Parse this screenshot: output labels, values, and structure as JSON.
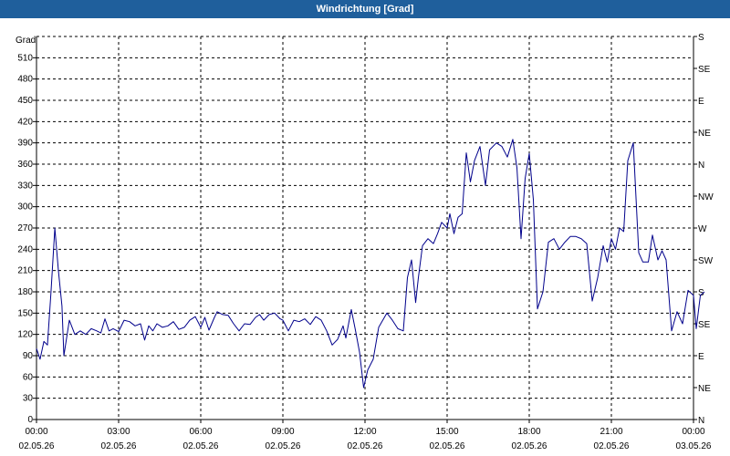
{
  "window": {
    "title": "Windrichtung [Grad]"
  },
  "chart_data": {
    "type": "line",
    "ylabel": "Grad",
    "ylim": [
      0,
      540
    ],
    "y_ticks": [
      0,
      30,
      60,
      90,
      120,
      150,
      180,
      210,
      240,
      270,
      300,
      330,
      360,
      390,
      420,
      450,
      480,
      510
    ],
    "right_axis_labels": [
      {
        "y": 0,
        "label": "N"
      },
      {
        "y": 45,
        "label": "NE"
      },
      {
        "y": 90,
        "label": "E"
      },
      {
        "y": 135,
        "label": "SE"
      },
      {
        "y": 180,
        "label": "S"
      },
      {
        "y": 225,
        "label": "SW"
      },
      {
        "y": 270,
        "label": "W"
      },
      {
        "y": 315,
        "label": "NW"
      },
      {
        "y": 360,
        "label": "N"
      },
      {
        "y": 405,
        "label": "NE"
      },
      {
        "y": 450,
        "label": "E"
      },
      {
        "y": 495,
        "label": "SE"
      },
      {
        "y": 540,
        "label": "S"
      }
    ],
    "x_ticks": [
      {
        "hour": 0,
        "time": "00:00",
        "date": "02.05.26"
      },
      {
        "hour": 3,
        "time": "03:00",
        "date": "02.05.26"
      },
      {
        "hour": 6,
        "time": "06:00",
        "date": "02.05.26"
      },
      {
        "hour": 9,
        "time": "09:00",
        "date": "02.05.26"
      },
      {
        "hour": 12,
        "time": "12:00",
        "date": "02.05.26"
      },
      {
        "hour": 15,
        "time": "15:00",
        "date": "02.05.26"
      },
      {
        "hour": 18,
        "time": "18:00",
        "date": "02.05.26"
      },
      {
        "hour": 21,
        "time": "21:00",
        "date": "02.05.26"
      },
      {
        "hour": 24,
        "time": "00:00",
        "date": "03.05.26"
      }
    ],
    "grid": true,
    "series_color": "#00008b",
    "series": [
      {
        "points": [
          [
            0.0,
            100
          ],
          [
            0.13,
            85
          ],
          [
            0.27,
            110
          ],
          [
            0.4,
            105
          ],
          [
            0.53,
            180
          ],
          [
            0.67,
            270
          ],
          [
            0.8,
            210
          ],
          [
            0.93,
            160
          ],
          [
            1.0,
            90
          ],
          [
            1.2,
            140
          ],
          [
            1.4,
            120
          ],
          [
            1.6,
            125
          ],
          [
            1.8,
            120
          ],
          [
            2.0,
            128
          ],
          [
            2.2,
            125
          ],
          [
            2.35,
            122
          ],
          [
            2.5,
            142
          ],
          [
            2.65,
            125
          ],
          [
            2.8,
            128
          ],
          [
            3.0,
            124
          ],
          [
            3.2,
            140
          ],
          [
            3.4,
            138
          ],
          [
            3.6,
            132
          ],
          [
            3.8,
            135
          ],
          [
            3.95,
            112
          ],
          [
            4.1,
            132
          ],
          [
            4.25,
            125
          ],
          [
            4.4,
            135
          ],
          [
            4.6,
            130
          ],
          [
            4.8,
            132
          ],
          [
            5.0,
            138
          ],
          [
            5.2,
            127
          ],
          [
            5.4,
            130
          ],
          [
            5.6,
            140
          ],
          [
            5.8,
            145
          ],
          [
            6.0,
            130
          ],
          [
            6.15,
            144
          ],
          [
            6.3,
            126
          ],
          [
            6.5,
            144
          ],
          [
            6.6,
            152
          ],
          [
            6.8,
            148
          ],
          [
            7.0,
            147
          ],
          [
            7.2,
            135
          ],
          [
            7.4,
            125
          ],
          [
            7.6,
            135
          ],
          [
            7.8,
            134
          ],
          [
            8.0,
            144
          ],
          [
            8.15,
            148
          ],
          [
            8.3,
            140
          ],
          [
            8.5,
            148
          ],
          [
            8.7,
            150
          ],
          [
            8.9,
            142
          ],
          [
            9.0,
            140
          ],
          [
            9.2,
            125
          ],
          [
            9.4,
            140
          ],
          [
            9.6,
            138
          ],
          [
            9.8,
            142
          ],
          [
            10.0,
            134
          ],
          [
            10.2,
            145
          ],
          [
            10.4,
            140
          ],
          [
            10.6,
            125
          ],
          [
            10.8,
            105
          ],
          [
            11.0,
            113
          ],
          [
            11.2,
            132
          ],
          [
            11.3,
            115
          ],
          [
            11.5,
            155
          ],
          [
            11.65,
            126
          ],
          [
            11.8,
            95
          ],
          [
            11.95,
            45
          ],
          [
            12.1,
            70
          ],
          [
            12.3,
            85
          ],
          [
            12.5,
            130
          ],
          [
            12.8,
            150
          ],
          [
            13.0,
            140
          ],
          [
            13.2,
            128
          ],
          [
            13.4,
            125
          ],
          [
            13.55,
            200
          ],
          [
            13.7,
            225
          ],
          [
            13.85,
            165
          ],
          [
            13.95,
            200
          ],
          [
            14.1,
            245
          ],
          [
            14.3,
            255
          ],
          [
            14.5,
            248
          ],
          [
            14.65,
            262
          ],
          [
            14.8,
            278
          ],
          [
            15.0,
            270
          ],
          [
            15.1,
            290
          ],
          [
            15.25,
            262
          ],
          [
            15.4,
            285
          ],
          [
            15.55,
            290
          ],
          [
            15.7,
            376
          ],
          [
            15.85,
            335
          ],
          [
            16.0,
            365
          ],
          [
            16.2,
            385
          ],
          [
            16.4,
            330
          ],
          [
            16.55,
            380
          ],
          [
            16.8,
            390
          ],
          [
            17.0,
            385
          ],
          [
            17.2,
            370
          ],
          [
            17.4,
            395
          ],
          [
            17.55,
            355
          ],
          [
            17.7,
            255
          ],
          [
            17.85,
            340
          ],
          [
            18.0,
            375
          ],
          [
            18.15,
            310
          ],
          [
            18.3,
            156
          ],
          [
            18.5,
            180
          ],
          [
            18.7,
            250
          ],
          [
            18.9,
            255
          ],
          [
            19.1,
            240
          ],
          [
            19.3,
            250
          ],
          [
            19.5,
            258
          ],
          [
            19.7,
            258
          ],
          [
            19.9,
            255
          ],
          [
            20.1,
            248
          ],
          [
            20.3,
            167
          ],
          [
            20.5,
            200
          ],
          [
            20.7,
            245
          ],
          [
            20.85,
            222
          ],
          [
            21.0,
            255
          ],
          [
            21.15,
            240
          ],
          [
            21.3,
            270
          ],
          [
            21.45,
            265
          ],
          [
            21.6,
            365
          ],
          [
            21.8,
            390
          ],
          [
            22.0,
            235
          ],
          [
            22.15,
            222
          ],
          [
            22.35,
            222
          ],
          [
            22.5,
            260
          ],
          [
            22.7,
            225
          ],
          [
            22.85,
            238
          ],
          [
            23.0,
            225
          ],
          [
            23.2,
            125
          ],
          [
            23.4,
            152
          ],
          [
            23.6,
            135
          ],
          [
            23.8,
            182
          ],
          [
            24.0,
            175
          ],
          [
            24.1,
            128
          ],
          [
            24.25,
            175
          ],
          [
            24.4,
            180
          ]
        ]
      }
    ]
  }
}
